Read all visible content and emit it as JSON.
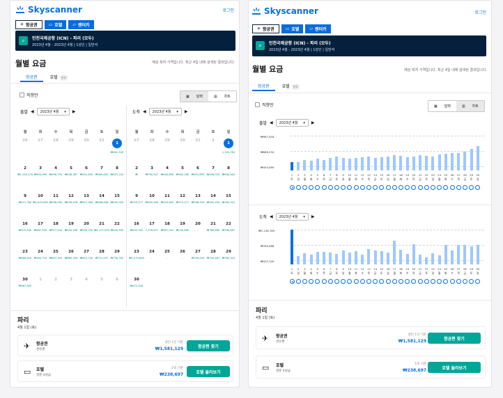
{
  "left": {
    "logo": "Skyscanner",
    "login": "로그인",
    "tabs": [
      "항공권",
      "호텔",
      "렌터카"
    ],
    "route": "인천국제공항 (ICN) - 파리 (모두)",
    "meta": "2023년 4월 - 2023년 4월 | 1성인 | 일반석",
    "title": "월별 요금",
    "note": "예상 최저 가격입니다. 최근 4일 내에 검색된 결과입니다.",
    "subtabs": [
      "항공권",
      "호텔",
      "신규"
    ],
    "direct": "직항만",
    "toggle": [
      "달력",
      "차트"
    ],
    "dep_label": "출발",
    "ret_label": "도착",
    "month": "2023년 4월",
    "day_names": [
      "월",
      "화",
      "수",
      "목",
      "금",
      "토",
      "일"
    ],
    "dep": [
      [
        "26",
        "",
        "27",
        "",
        "28",
        "",
        "29",
        "",
        "30",
        "",
        "31",
        "",
        "1",
        "₩402,340"
      ],
      [
        "2",
        "₩1,140,176",
        "3",
        "₩404,890",
        "4",
        "₩456,790",
        "5",
        "₩408,387",
        "6",
        "₩501,800",
        "7",
        "₩580,600",
        "8",
        "₩551,100"
      ],
      [
        "9",
        "₩571,780",
        "10",
        "₩1,009,085",
        "11",
        "₩558,060",
        "12",
        "₩436,458",
        "13",
        "₩527,380",
        "14",
        "₩468,648",
        "15",
        "₩500,900"
      ],
      [
        "16",
        "₩570,300",
        "17",
        "₩587,500",
        "18",
        "₩517,440",
        "19",
        "₩534,208",
        "20",
        "₩526,700",
        "21",
        "₩1,171,000",
        "22",
        "₩530,500"
      ],
      [
        "23",
        "₩668,620",
        "24",
        "₩490,750",
        "25",
        "₩897,500",
        "26",
        "₩669,784",
        "27",
        "₩619,700",
        "28",
        "₩721,007",
        "29",
        "₩738,762"
      ],
      [
        "30",
        "₩567,800",
        "1",
        "",
        "2",
        "",
        "3",
        "",
        "4",
        "",
        "5",
        "",
        "6",
        ""
      ]
    ],
    "ret": [
      [
        "27",
        "",
        "28",
        "",
        "29",
        "",
        "30",
        "",
        "31",
        "",
        "1",
        "",
        "1",
        "1,140,783"
      ],
      [
        "2",
        "₩",
        "3",
        "₩790,947",
        "4",
        "₩404,890",
        "5",
        "₩562,180",
        "6",
        "₩503,899",
        "7",
        "₩498,920",
        "8",
        "₩508,600"
      ],
      [
        "9",
        "₩729,977",
        "10",
        "₩405,485",
        "11",
        "₩404,890",
        "12",
        "₩715,077",
        "13",
        "₩538,509",
        "14",
        "₩502,500",
        "15",
        "₩780,310"
      ],
      [
        "16",
        "₩432,340",
        "17",
        "1,128,497",
        "18",
        "₩607,023",
        "19",
        "₩740,880",
        "20",
        "-",
        "21",
        "₩780,880",
        "22",
        "₩780,887"
      ],
      [
        "23",
        "₩1,079,883",
        "24",
        "-",
        "25",
        "-",
        "26",
        "-",
        "27",
        "₩740,044",
        "28",
        "₩734,487",
        "29",
        "₩760,310"
      ],
      [
        "30",
        "₩972,528",
        "",
        "",
        "",
        "",
        "",
        "",
        "",
        "",
        "",
        "",
        "",
        ""
      ]
    ],
    "city": "파리",
    "date": "4월 1일 (토)",
    "flight_name": "항공권",
    "flight_sub": "경유편",
    "flight_label": "성인 1인 기준",
    "flight_price": "₩1,581,129",
    "flight_btn": "항공편 찾기",
    "hotel_name": "호텔",
    "hotel_sub": "경준 4성급",
    "hotel_label": "1박 기준",
    "hotel_price": "₩238,697",
    "hotel_btn": "호텔 둘러보기"
  },
  "right": {
    "logo": "Skyscanner",
    "login": "로그인",
    "tabs": [
      "항공권",
      "호텔",
      "렌터카"
    ],
    "route": "인천국제공항 (ICN) - 파리 (모두)",
    "meta": "2023년 4월 - 2023년 4월 | 1성인 | 일반석",
    "title": "월별 요금",
    "note": "예상 최저 가격입니다. 최근 4일 내에 검색된 결과입니다.",
    "subtabs": [
      "항공권",
      "호텔",
      "신규"
    ],
    "direct": "직항만",
    "toggle": [
      "달력",
      "차트"
    ],
    "dep_label": "출발",
    "ret_label": "도착",
    "month": "2023년 4월",
    "dep_ticks": [
      "₩967,818",
      "₩686,234",
      "₩404,890"
    ],
    "ret_ticks": [
      "₩1,148,789",
      "₩780,888",
      "₩432,340"
    ],
    "x_days": [
      "1",
      "2",
      "3",
      "4",
      "5",
      "6",
      "7",
      "8",
      "9",
      "10",
      "11",
      "12",
      "13",
      "14",
      "15",
      "16",
      "17",
      "18",
      "19",
      "20",
      "21",
      "22",
      "23",
      "24",
      "25",
      "26",
      "27",
      "28",
      "29",
      "30"
    ],
    "x_weekdays": [
      "토",
      "일",
      "월",
      "화",
      "수",
      "목",
      "금",
      "토",
      "일",
      "월",
      "화",
      "수",
      "목",
      "금",
      "토",
      "일",
      "월",
      "화",
      "수",
      "목",
      "금",
      "토",
      "일",
      "월",
      "화",
      "수",
      "목",
      "금",
      "토",
      "일"
    ],
    "dep_values": [
      430000,
      440000,
      470000,
      455000,
      505000,
      480000,
      520000,
      540000,
      520000,
      500000,
      520000,
      530000,
      540000,
      520000,
      525000,
      550000,
      570000,
      560000,
      530000,
      540000,
      570000,
      560000,
      545000,
      590000,
      600000,
      620000,
      610000,
      650000,
      700000,
      760000
    ],
    "ret_values": [
      1148789,
      460000,
      540000,
      505000,
      580000,
      580000,
      560000,
      520000,
      610000,
      560000,
      590000,
      500000,
      640000,
      610000,
      600000,
      560000,
      860000,
      630000,
      520000,
      780000,
      510000,
      440000,
      535000,
      480000,
      760000,
      620000,
      750000,
      760000,
      720000,
      760000
    ],
    "city": "파리",
    "date": "4월 1일 (토)",
    "flight_name": "항공권",
    "flight_sub": "경유편",
    "flight_label": "성인 1인 기준",
    "flight_price": "₩1,581,129",
    "flight_btn": "항공편 찾기",
    "hotel_name": "호텔",
    "hotel_sub": "경준 4성급",
    "hotel_label": "1박 기준",
    "hotel_price": "₩238,697",
    "hotel_btn": "호텔 둘러보기"
  },
  "chart_data": [
    {
      "type": "bar",
      "title": "",
      "xlabel": "",
      "ylabel": "",
      "series": [
        {
          "name": "",
          "values": [
            430000,
            440000,
            470000,
            455000,
            505000,
            480000,
            520000,
            540000,
            520000,
            500000,
            520000,
            530000,
            540000,
            520000,
            525000,
            550000,
            570000,
            560000,
            530000,
            540000,
            570000,
            560000,
            545000,
            590000,
            600000,
            620000,
            610000,
            650000,
            700000,
            760000
          ]
        }
      ],
      "categories": [
        "1",
        "2",
        "3",
        "4",
        "5",
        "6",
        "7",
        "8",
        "9",
        "10",
        "11",
        "12",
        "13",
        "14",
        "15",
        "16",
        "17",
        "18",
        "19",
        "20",
        "21",
        "22",
        "23",
        "24",
        "25",
        "26",
        "27",
        "28",
        "29",
        "30"
      ],
      "ylim": [
        404890,
        967818
      ]
    },
    {
      "type": "bar",
      "title": "",
      "xlabel": "",
      "ylabel": "",
      "series": [
        {
          "name": "",
          "values": [
            1148789,
            460000,
            540000,
            505000,
            580000,
            580000,
            560000,
            520000,
            610000,
            560000,
            590000,
            500000,
            640000,
            610000,
            600000,
            560000,
            860000,
            630000,
            520000,
            780000,
            510000,
            440000,
            535000,
            480000,
            760000,
            620000,
            750000,
            760000,
            720000,
            760000
          ]
        }
      ],
      "categories": [
        "1",
        "2",
        "3",
        "4",
        "5",
        "6",
        "7",
        "8",
        "9",
        "10",
        "11",
        "12",
        "13",
        "14",
        "15",
        "16",
        "17",
        "18",
        "19",
        "20",
        "21",
        "22",
        "23",
        "24",
        "25",
        "26",
        "27",
        "28",
        "29",
        "30"
      ],
      "ylim": [
        432340,
        1148789
      ]
    }
  ]
}
